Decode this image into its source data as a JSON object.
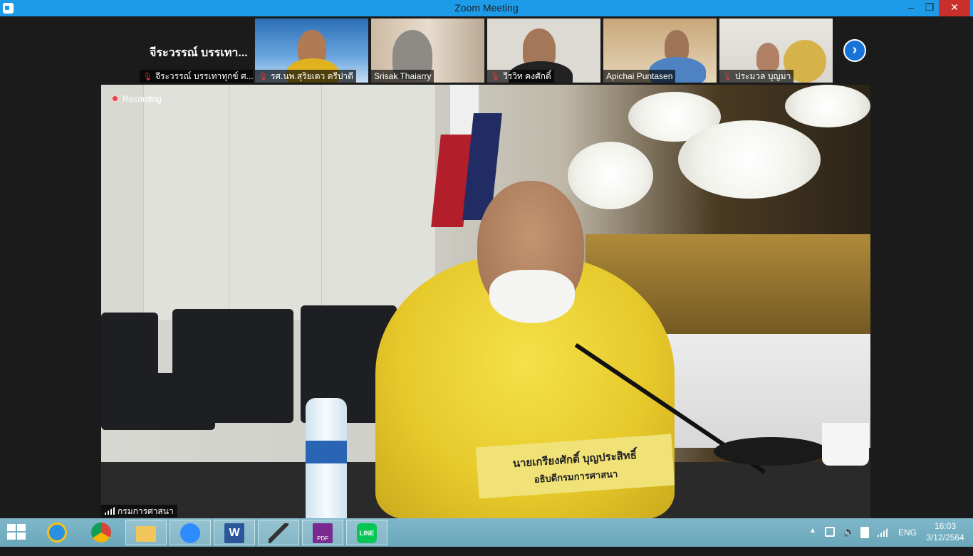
{
  "window": {
    "title": "Zoom Meeting",
    "minimize_symbol": "–",
    "maximize_symbol": "❐",
    "close_symbol": "✕"
  },
  "participants": [
    {
      "display_name": "จีระวรรณ์ บรรเทา...",
      "label": "จีระวรรณ์ บรรเทาทุกข์ ศ...",
      "muted": true,
      "video": false
    },
    {
      "label": "รศ.นพ.สุริยเดว ตรีปาตี",
      "muted": true,
      "video": true
    },
    {
      "label": "Srisak Thaiarry",
      "muted": false,
      "video": true
    },
    {
      "label": "วีรวิท คงศักดิ์",
      "muted": true,
      "video": true
    },
    {
      "label": "Apichai Puntasen",
      "muted": false,
      "video": true
    },
    {
      "label": "ประมวล บุญมา",
      "muted": true,
      "video": true
    }
  ],
  "next_page_icon": "chevron-right-icon",
  "main_video": {
    "recording_label": "Recording",
    "speaker_label": "กรมการศาสนา",
    "nameplate_line1": "นายเกรียงศักดิ์ บุญประสิทธิ์",
    "nameplate_line2": "อธิบดีกรมการศาสนา"
  },
  "taskbar": {
    "apps": [
      {
        "name": "internet-explorer",
        "pinned": false
      },
      {
        "name": "chrome",
        "pinned": false
      },
      {
        "name": "file-explorer",
        "pinned": true
      },
      {
        "name": "zoom",
        "pinned": true
      },
      {
        "name": "word",
        "pinned": true
      },
      {
        "name": "microphone-app",
        "pinned": true
      },
      {
        "name": "pdf",
        "pinned": true,
        "label": "PDF"
      },
      {
        "name": "line",
        "pinned": true,
        "label": "LINE"
      }
    ],
    "tray": {
      "language": "ENG",
      "time": "16:03",
      "date": "3/12/2564"
    }
  },
  "colors": {
    "titlebar": "#1e9be8",
    "close": "#c9302c",
    "zoom_blue": "#1674d8",
    "taskbar": "#72adc0",
    "muted": "#e03a3a"
  }
}
